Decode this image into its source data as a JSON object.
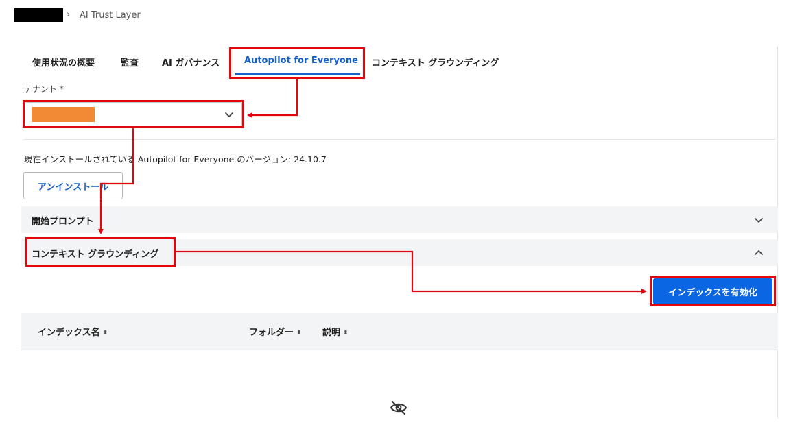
{
  "breadcrumb": {
    "separator": "›",
    "current": "AI Trust Layer"
  },
  "tabs": [
    {
      "label": "使用状況の概要",
      "active": false
    },
    {
      "label": "監査",
      "active": false
    },
    {
      "label": "AI ガバナンス",
      "active": false
    },
    {
      "label": "Autopilot for Everyone",
      "active": true
    },
    {
      "label": "コンテキスト グラウンディング",
      "active": false
    }
  ],
  "tenant": {
    "label": "テナント *",
    "value_redacted": true,
    "icon": "chevron-down-icon"
  },
  "version_text": "現在インストールされている Autopilot for Everyone のバージョン: 24.10.7",
  "uninstall_label": "アンインストール",
  "accordions": [
    {
      "title": "開始プロンプト",
      "expanded": false,
      "icon": "chevron-down-icon"
    },
    {
      "title": "コンテキスト グラウンディング",
      "expanded": true,
      "icon": "chevron-up-icon"
    }
  ],
  "enable_index_label": "インデックスを有効化",
  "table": {
    "columns": [
      {
        "label": "インデックス名",
        "sort_icon": "sort-icon"
      },
      {
        "label": "フォルダー",
        "sort_icon": "sort-icon"
      },
      {
        "label": "説明",
        "sort_icon": "sort-icon"
      }
    ],
    "sort_glyph": "⬍",
    "empty_icon": "eye-off-icon"
  },
  "colors": {
    "accent": "#1560c9",
    "button_primary": "#0b66e4",
    "annotation": "#e3060d",
    "redaction_orange": "#f08a34"
  }
}
